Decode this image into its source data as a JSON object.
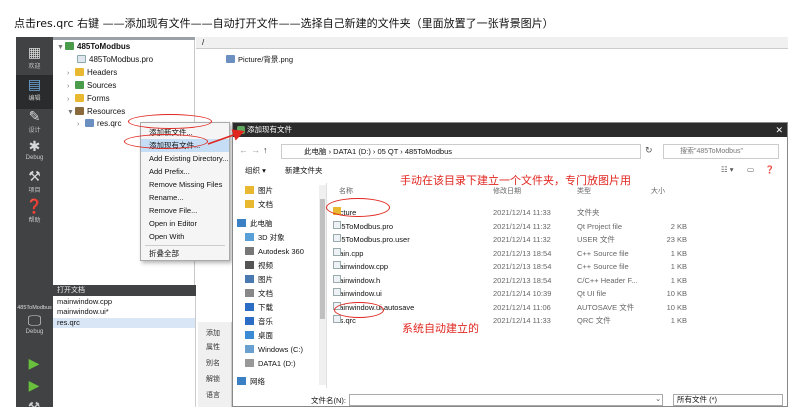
{
  "caption": "点击res.qrc 右键 ——添加现有文件——自动打开文件——选择自己新建的文件夹（里面放置了一张背景图片）",
  "modebar": {
    "items": [
      {
        "label": "欢迎",
        "icon": "grid-icon"
      },
      {
        "label": "编辑",
        "icon": "edit-icon"
      },
      {
        "label": "设计",
        "icon": "pen-icon"
      },
      {
        "label": "Debug",
        "icon": "bug-icon"
      },
      {
        "label": "项目",
        "icon": "wrench-icon"
      },
      {
        "label": "帮助",
        "icon": "help-icon"
      }
    ],
    "kit_label": "485ToModbus",
    "debug_label": "Debug"
  },
  "project_tree": {
    "root": "485ToModbus",
    "items": [
      "485ToModbus.pro",
      "Headers",
      "Sources",
      "Forms",
      "Resources",
      "res.qrc"
    ]
  },
  "editor": {
    "path": "/",
    "files": [
      "Picture/背景.png"
    ]
  },
  "context_menu": {
    "items": [
      "添加新文件...",
      "添加现有文件...",
      "Add Existing Directory...",
      "Add Prefix...",
      "Remove Missing Files",
      "Rename...",
      "Remove File...",
      "Open in Editor",
      "Open With",
      "折叠全部"
    ]
  },
  "open_documents": {
    "title": "打开文档",
    "items": [
      "mainwindow.cpp",
      "mainwindow.ui*",
      "res.qrc"
    ]
  },
  "side_strip": {
    "items": [
      "添加",
      "属性",
      "别名",
      "解锁",
      "语言"
    ]
  },
  "dialog": {
    "title": "添加现有文件",
    "breadcrumb": [
      "此电脑",
      "DATA1 (D:)",
      "05 QT",
      "485ToModbus"
    ],
    "search_placeholder": "搜索\"485ToModbus\"",
    "organize_label": "组织 ▾",
    "new_folder_label": "新建文件夹",
    "columns": {
      "name": "名称",
      "date": "修改日期",
      "type": "类型",
      "size": "大小"
    },
    "nav_items": [
      "图片",
      "文档",
      "此电脑",
      "3D 对象",
      "Autodesk 360",
      "视频",
      "图片",
      "文档",
      "下载",
      "音乐",
      "桌面",
      "Windows (C:)",
      "DATA1 (D:)",
      "网络"
    ],
    "files": [
      {
        "name": "Picture",
        "date": "2021/12/14 11:33",
        "type": "文件夹",
        "size": "",
        "kind": "folder"
      },
      {
        "name": "485ToModbus.pro",
        "date": "2021/12/14 11:32",
        "type": "Qt Project file",
        "size": "2 KB",
        "kind": "file"
      },
      {
        "name": "485ToModbus.pro.user",
        "date": "2021/12/14 11:32",
        "type": "USER 文件",
        "size": "23 KB",
        "kind": "file"
      },
      {
        "name": "main.cpp",
        "date": "2021/12/13 18:54",
        "type": "C++ Source file",
        "size": "1 KB",
        "kind": "file"
      },
      {
        "name": "mainwindow.cpp",
        "date": "2021/12/13 18:54",
        "type": "C++ Source file",
        "size": "1 KB",
        "kind": "file"
      },
      {
        "name": "mainwindow.h",
        "date": "2021/12/13 18:54",
        "type": "C/C++ Header F...",
        "size": "1 KB",
        "kind": "file"
      },
      {
        "name": "mainwindow.ui",
        "date": "2021/12/14 10:39",
        "type": "Qt UI file",
        "size": "10 KB",
        "kind": "file"
      },
      {
        "name": "mainwindow.ui.autosave",
        "date": "2021/12/14 11:06",
        "type": "AUTOSAVE 文件",
        "size": "10 KB",
        "kind": "file"
      },
      {
        "name": "res.qrc",
        "date": "2021/12/14 11:33",
        "type": "QRC 文件",
        "size": "1 KB",
        "kind": "file"
      }
    ],
    "filename_label": "文件名(N):",
    "filetype_value": "所有文件 (*)"
  },
  "annotations": {
    "folder_note": "手动在该目录下建立一个文件夹，专门放图片用",
    "qrc_note": "系统自动建立的"
  },
  "colors": {
    "annotation": "#e0261f",
    "modebar": "#404244",
    "highlight": "#c6ddf6"
  }
}
